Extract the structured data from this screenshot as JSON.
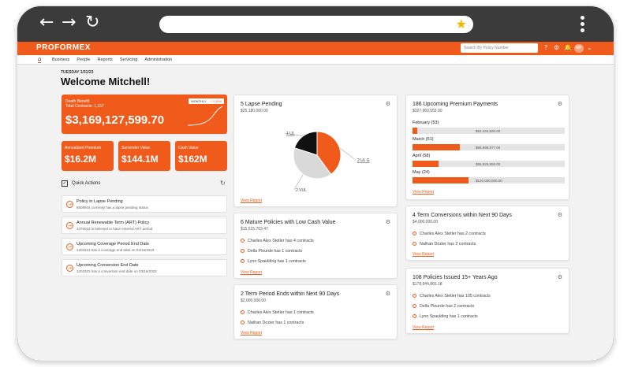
{
  "browser": {
    "back": "←",
    "forward": "→",
    "reload": "↻",
    "star": "★"
  },
  "header": {
    "logo": "PROFORMEX",
    "search_placeholder": "Search By Policy Number",
    "avatar_initials": "MP",
    "accent": "#f05a1a"
  },
  "menu": [
    "Business",
    "People",
    "Reports",
    "Servicing",
    "Administration"
  ],
  "date": "TUESDAY 1/31/23",
  "welcome": "Welcome Mitchell!",
  "death_benefit": {
    "label": "Death Benefit",
    "contracts": "Total Contracts: 1,157",
    "value": "$3,169,127,599.70",
    "badge_period": "MONTHLY",
    "badge_change": "↑ 0.39%"
  },
  "stats": [
    {
      "label": "Annualized Premium",
      "value": "$16.2M"
    },
    {
      "label": "Surrender Value",
      "value": "$144.1M"
    },
    {
      "label": "Cash Value",
      "value": "$162M"
    }
  ],
  "quick_actions": {
    "title": "Quick Actions",
    "items": [
      {
        "title": "Policy in Lapse Pending",
        "sub": "6609944 currently has a lapse pending status"
      },
      {
        "title": "Annual Renewable Term (ART) Policy",
        "sub": "4376023 is believed to have entered ART period"
      },
      {
        "title": "Upcoming Coverage Period End Date",
        "sub": "1203323 has a coverage end date on 03/16/2023"
      },
      {
        "title": "Upcoming Conversion End Date",
        "sub": "1203323 has a conversion end date on 03/16/2023"
      }
    ]
  },
  "lapse": {
    "title": "5 Lapse Pending",
    "sub": "$25,180,000.00",
    "view": "View Report",
    "slices": [
      {
        "label": "2 UL G",
        "value": 2,
        "color": "#f05a1a"
      },
      {
        "label": "2 VUL",
        "value": 2,
        "color": "#d9d9d9"
      },
      {
        "label": "1 UL",
        "value": 1,
        "color": "#111111"
      }
    ]
  },
  "mature": {
    "title": "6 Mature Policies with Low Cash Value",
    "sub": "$15,515,703.47",
    "items": [
      "Charles Alex Stetler has 4 contracts",
      "Della Plourde has 1 contracts",
      "Lynn Spaulding has 1 contracts"
    ],
    "view": "View Report"
  },
  "term_period": {
    "title": "2 Term Period Ends within Next 90 Days",
    "sub": "$2,000,000.00",
    "items": [
      "Charles Alex Stetler has 1 contracts",
      "Nathan Dozier has 1 contracts"
    ],
    "view": "View Report"
  },
  "upcoming": {
    "title": "186 Upcoming Premium Payments",
    "sub": "$327,960,655.00",
    "months": [
      {
        "label": "February (53)",
        "amount": "$52,434,820.00",
        "fill": 0.03
      },
      {
        "label": "March (51)",
        "amount": "$99,999,977.00",
        "fill": 0.31
      },
      {
        "label": "April (58)",
        "amount": "$55,525,858.00",
        "fill": 0.17
      },
      {
        "label": "May (24)",
        "amount": "$120,000,000.00",
        "fill": 0.37
      }
    ],
    "view": "View Report"
  },
  "conversions": {
    "title": "4 Term Conversions within Next 90 Days",
    "sub": "$4,000,000.00",
    "items": [
      "Charles Alex Stetler has 2 contracts",
      "Nathan Dozier has 2 contracts"
    ],
    "view": "View Report"
  },
  "issued": {
    "title": "108 Policies Issued 15+ Years Ago",
    "sub": "$178,944,865.18",
    "items": [
      "Charles Alex Stetler has 105 contracts",
      "Della Plourde has 2 contracts",
      "Lynn Spaulding has 1 contracts"
    ],
    "view": "View Report"
  }
}
